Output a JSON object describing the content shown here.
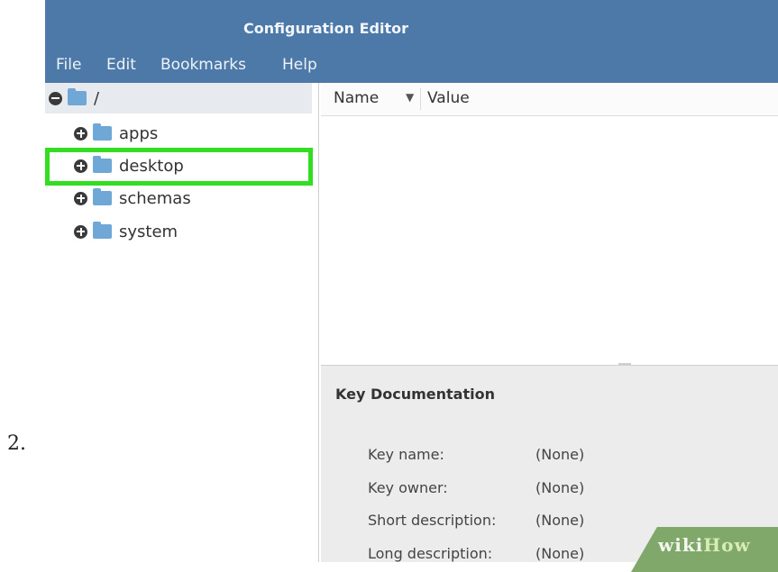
{
  "step_number": "2.",
  "window": {
    "title": "Configuration Editor"
  },
  "menu": [
    "File",
    "Edit",
    "Bookmarks",
    "Help"
  ],
  "tree": {
    "root_label": "/",
    "children": [
      "apps",
      "desktop",
      "schemas",
      "system"
    ],
    "highlighted": "desktop"
  },
  "list": {
    "col_name": "Name",
    "col_value": "Value"
  },
  "documentation": {
    "title": "Key Documentation",
    "fields": [
      {
        "label": "Key name:",
        "value": "(None)"
      },
      {
        "label": "Key owner:",
        "value": "(None)"
      },
      {
        "label": "Short description:",
        "value": "(None)"
      },
      {
        "label": "Long description:",
        "value": "(None)"
      }
    ]
  },
  "watermark": {
    "part1": "wiki",
    "part2": "How"
  },
  "colors": {
    "titlebar": "#4c79a8",
    "highlight": "#33dd22",
    "folder": "#6fa7d6"
  },
  "icons": [
    "expander-minus-icon",
    "expander-plus-icon",
    "folder-icon",
    "sort-down-icon"
  ]
}
